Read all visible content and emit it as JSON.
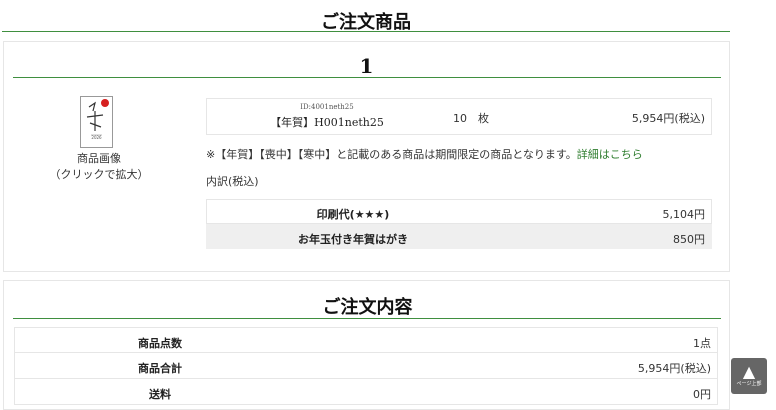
{
  "page": {
    "heading": "ご注文商品"
  },
  "item": {
    "number": "1",
    "thumb_caption_1": "商品画像",
    "thumb_caption_2": "（クリックで拡大）",
    "thumb_year": "2026",
    "product_id": "ID:4001neth25",
    "product_name": "【年賀】H001neth25",
    "quantity": "10　枚",
    "price": "5,954円(税込)",
    "notice_text": "※【年賀】【喪中】【寒中】と記載のある商品は期間限定の商品となります。",
    "notice_link": "詳細はこちら",
    "breakdown_label": "内訳(税込)",
    "breakdown": [
      {
        "label": "印刷代(★★★)",
        "value": "5,104円"
      },
      {
        "label": "お年玉付き年賀はがき",
        "value": "850円"
      }
    ]
  },
  "summary": {
    "heading": "ご注文内容",
    "rows": [
      {
        "label": "商品点数",
        "value": "1点"
      },
      {
        "label": "商品合計",
        "value": "5,954円(税込)"
      },
      {
        "label": "送料",
        "value": "0円"
      }
    ]
  },
  "page_top": {
    "label": "ページ上部"
  },
  "colors": {
    "accent_green": "#3f8f3f",
    "link_green": "#2e7d2e",
    "row_shade": "#efefef"
  }
}
